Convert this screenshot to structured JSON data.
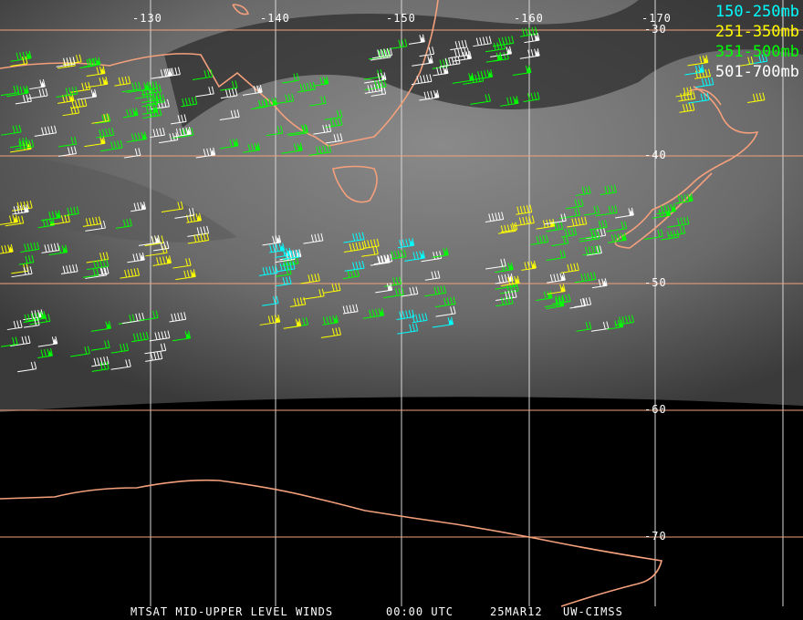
{
  "title": "MTSAT MID-UPPER LEVEL WINDS",
  "time": "00:00 UTC",
  "date": "25MAR12",
  "credit": "UW-CIMSS",
  "longitude_labels": [
    "-130",
    "-140",
    "-150",
    "-160",
    "-170"
  ],
  "latitude_labels": [
    "-30",
    "-40",
    "-50",
    "-60",
    "-70"
  ],
  "legend": [
    {
      "label": "150-250mb",
      "color": "#00ffff"
    },
    {
      "label": "251-350mb",
      "color": "#ffff00"
    },
    {
      "label": "351-500mb",
      "color": "#00ff00"
    },
    {
      "label": "501-700mb",
      "color": "#ffffff"
    }
  ],
  "colors": {
    "coast": "#f4a07c",
    "grid": "#f4a07c",
    "grid_v": "#d8d8d8"
  }
}
